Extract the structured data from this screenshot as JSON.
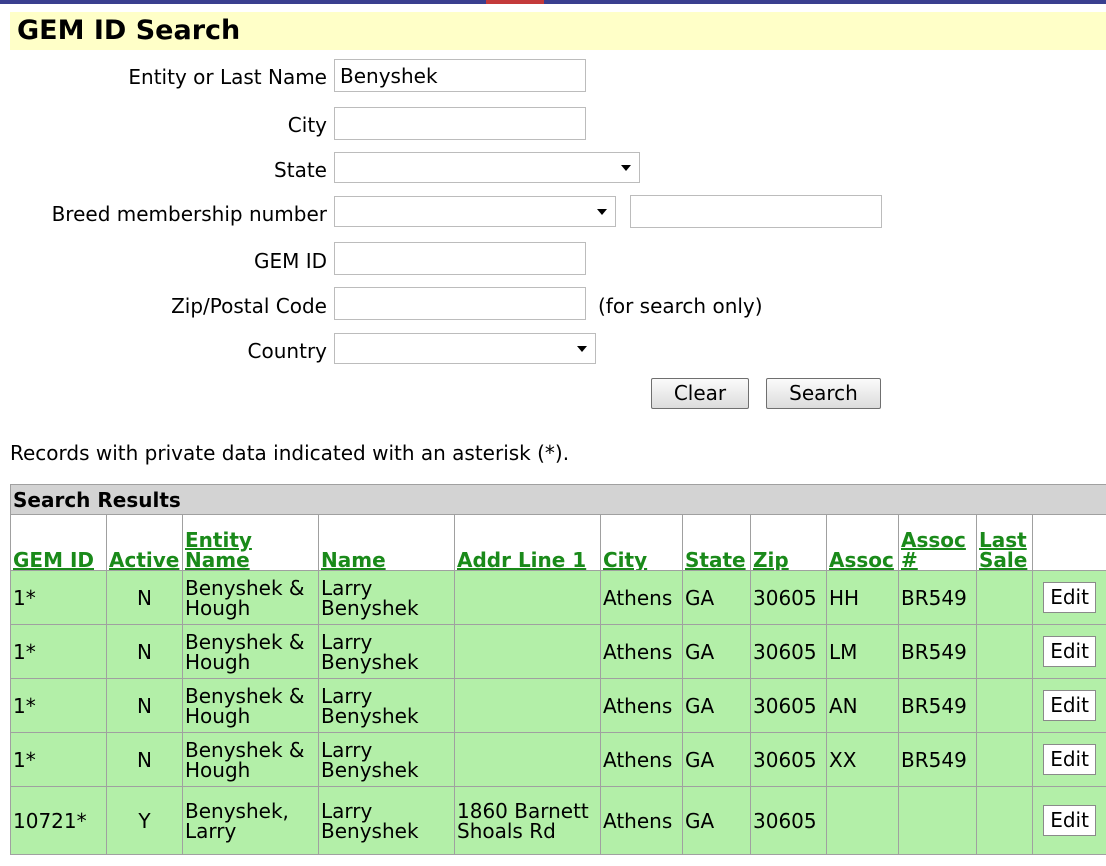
{
  "title": "GEM ID Search",
  "form": {
    "entity_label": "Entity or Last Name",
    "entity_value": "Benyshek",
    "city_label": "City",
    "city_value": "",
    "state_label": "State",
    "breed_label": "Breed membership number",
    "breed_value": "",
    "gemid_label": "GEM ID",
    "gemid_value": "",
    "zip_label": "Zip/Postal Code",
    "zip_value": "",
    "zip_note": "(for search only)",
    "country_label": "Country",
    "clear_label": "Clear",
    "search_label": "Search"
  },
  "info_text": "Records with private data indicated with an asterisk (*).",
  "results": {
    "caption": "Search Results",
    "columns": [
      "GEM ID",
      "Active",
      "Entity Name",
      "Name",
      "Addr Line 1",
      "City",
      "State",
      "Zip",
      "Assoc",
      "Assoc #",
      "Last Sale"
    ],
    "edit_label": "Edit",
    "rows": [
      {
        "gem_id": "1*",
        "active": "N",
        "entity_name": "Benyshek & Hough",
        "name": "Larry Benyshek",
        "addr": "",
        "city": "Athens",
        "state": "GA",
        "zip": "30605",
        "assoc": "HH",
        "assoc_num": "BR549",
        "last_sale": ""
      },
      {
        "gem_id": "1*",
        "active": "N",
        "entity_name": "Benyshek & Hough",
        "name": "Larry Benyshek",
        "addr": "",
        "city": "Athens",
        "state": "GA",
        "zip": "30605",
        "assoc": "LM",
        "assoc_num": "BR549",
        "last_sale": ""
      },
      {
        "gem_id": "1*",
        "active": "N",
        "entity_name": "Benyshek & Hough",
        "name": "Larry Benyshek",
        "addr": "",
        "city": "Athens",
        "state": "GA",
        "zip": "30605",
        "assoc": "AN",
        "assoc_num": "BR549",
        "last_sale": ""
      },
      {
        "gem_id": "1*",
        "active": "N",
        "entity_name": "Benyshek & Hough",
        "name": "Larry Benyshek",
        "addr": "",
        "city": "Athens",
        "state": "GA",
        "zip": "30605",
        "assoc": "XX",
        "assoc_num": "BR549",
        "last_sale": ""
      },
      {
        "gem_id": "10721*",
        "active": "Y",
        "entity_name": "Benyshek, Larry",
        "name": "Larry Benyshek",
        "addr": "1860 Barnett Shoals Rd",
        "city": "Athens",
        "state": "GA",
        "zip": "30605",
        "assoc": "",
        "assoc_num": "",
        "last_sale": ""
      }
    ]
  }
}
